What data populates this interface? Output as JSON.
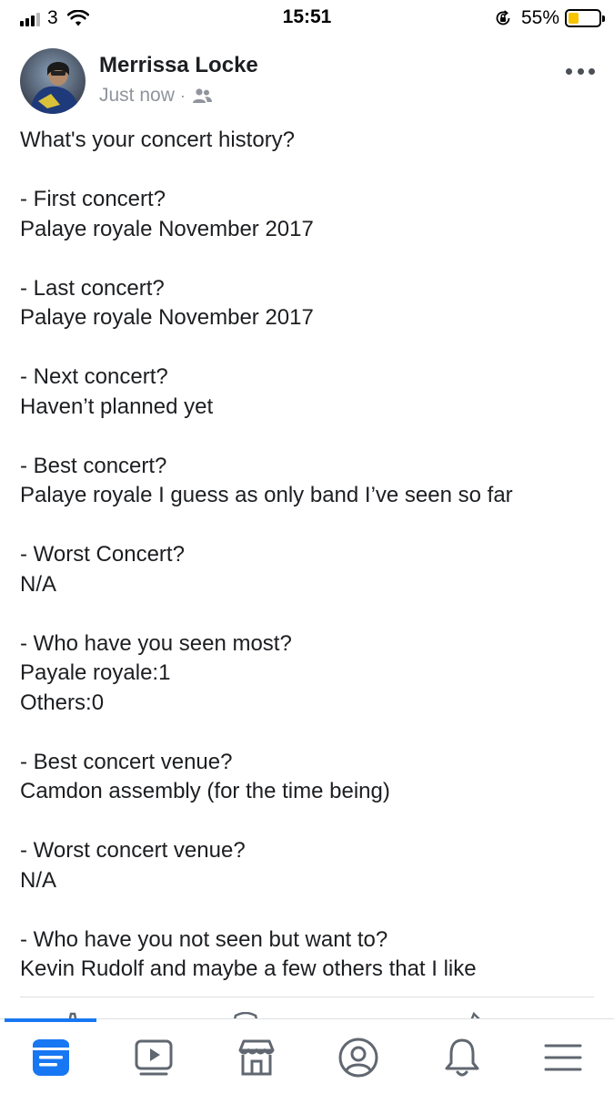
{
  "status_bar": {
    "carrier": "3",
    "time": "15:51",
    "battery_percent": "55%",
    "battery_level": 0.55,
    "battery_color": "#f7c400"
  },
  "post": {
    "author": "Merrissa Locke",
    "timestamp": "Just now",
    "separator": "·",
    "audience_icon": "friends-icon",
    "lines": [
      "What's your concert history?",
      "",
      "- First concert?",
      "Palaye royale November 2017",
      "",
      "- Last concert?",
      "Palaye royale November 2017",
      "",
      "- Next concert?",
      "Haven’t planned yet",
      "",
      "- Best concert?",
      "Palaye royale I guess as only band I’ve seen so far",
      "",
      "- Worst Concert?",
      "N/A",
      "",
      "- Who have you seen most?",
      "Payale royale:1",
      "Others:0",
      "",
      "- Best concert venue?",
      "Camdon assembly (for the time being)",
      "",
      "- Worst concert venue?",
      "N/A",
      "",
      "- Who have you not seen but want to?",
      "Kevin Rudolf and maybe a few others that I like"
    ]
  },
  "tab_bar": {
    "tabs": [
      "news-feed-icon",
      "watch-icon",
      "marketplace-icon",
      "profile-icon",
      "notifications-icon",
      "menu-icon"
    ],
    "active_index": 0,
    "active_color": "#1877f2",
    "inactive_color": "#606770"
  }
}
